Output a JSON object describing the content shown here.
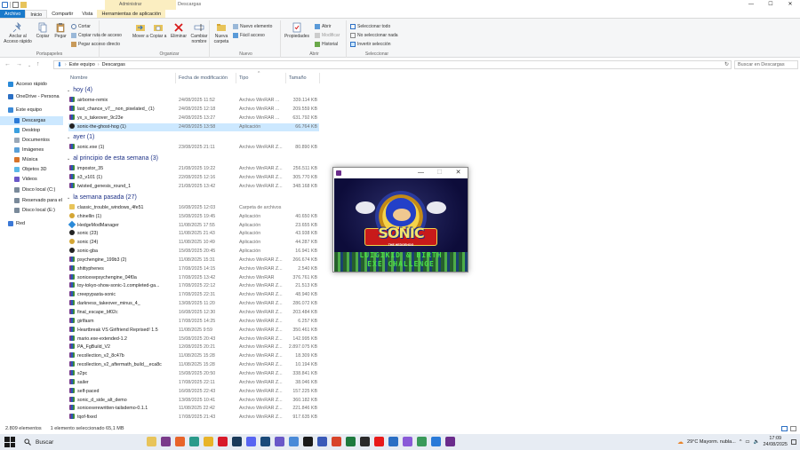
{
  "title": "Descargas",
  "context_tab": "Administrar",
  "ribbon_tabs": [
    "Archivo",
    "Inicio",
    "Compartir",
    "Vista",
    "Herramientas de aplicación"
  ],
  "window_controls": {
    "minimize": "—",
    "maximize": "☐",
    "close": "✕"
  },
  "ribbon": {
    "portapapeles": {
      "label": "Portapapeles",
      "anclar": "Anclar al Acceso rápido",
      "copiar": "Copiar",
      "pegar": "Pegar",
      "cortar": "Cortar",
      "copiar_ruta": "Copiar ruta de acceso",
      "pegar_acceso": "Pegar acceso directo"
    },
    "organizar": {
      "label": "Organizar",
      "mover": "Mover a",
      "copiar": "Copiar a",
      "eliminar": "Eliminar",
      "cambiar": "Cambiar nombre"
    },
    "nuevo": {
      "label": "Nuevo",
      "nueva_carpeta": "Nueva carpeta",
      "nuevo_elemento": "Nuevo elemento",
      "facil_acceso": "Fácil acceso"
    },
    "abrir": {
      "label": "Abrir",
      "propiedades": "Propiedades",
      "abrir": "Abrir",
      "modificar": "Modificar",
      "historial": "Historial"
    },
    "seleccionar": {
      "label": "Seleccionar",
      "todo": "Seleccionar todo",
      "nada": "No seleccionar nada",
      "invertir": "Invertir selección"
    }
  },
  "address": {
    "path": [
      "Este equipo",
      "Descargas"
    ],
    "search_placeholder": "Buscar en Descargas"
  },
  "nav": [
    {
      "label": "Acceso rápido",
      "icon": "star-icon",
      "color": "#2a8ad8"
    },
    {
      "label": "OneDrive - Persona",
      "icon": "cloud-icon",
      "color": "#2b6fc4"
    },
    {
      "label": "Este equipo",
      "icon": "computer-icon",
      "color": "#3b8ad8"
    },
    {
      "label": "Descargas",
      "icon": "download-icon",
      "color": "#2b7bd8",
      "selected": true
    },
    {
      "label": "Desktop",
      "icon": "desktop-icon",
      "color": "#3ba0e0"
    },
    {
      "label": "Documentos",
      "icon": "document-icon",
      "color": "#9aa8b8"
    },
    {
      "label": "Imágenes",
      "icon": "image-icon",
      "color": "#5aa0d8"
    },
    {
      "label": "Música",
      "icon": "music-icon",
      "color": "#d8742a"
    },
    {
      "label": "Objetos 3D",
      "icon": "cube-icon",
      "color": "#5ab8e8"
    },
    {
      "label": "Videos",
      "icon": "video-icon",
      "color": "#6a58c8"
    },
    {
      "label": "Disco local (C:)",
      "icon": "drive-icon",
      "color": "#7a8a9a"
    },
    {
      "label": "Reservado para el",
      "icon": "drive-icon",
      "color": "#7a8a9a"
    },
    {
      "label": "Disco local (E:)",
      "icon": "drive-icon",
      "color": "#7a8a9a"
    },
    {
      "label": "Red",
      "icon": "network-icon",
      "color": "#3b78d6"
    }
  ],
  "columns": {
    "name": "Nombre",
    "date": "Fecha de modificación",
    "type": "Tipo",
    "size": "Tamaño"
  },
  "groups": [
    {
      "header": "hoy (4)",
      "rows": [
        {
          "name": "airborne-remix",
          "date": "24/08/2025 11:52",
          "type": "Archivo WinRAR ...",
          "size": "339.114 KB",
          "icon": "rar"
        },
        {
          "name": "last_chance_v7__non_pixelated_ (1)",
          "date": "24/08/2025 12:18",
          "type": "Archivo WinRAR ...",
          "size": "209.559 KB",
          "icon": "rar"
        },
        {
          "name": "yx_s_takeover_9c23e",
          "date": "24/08/2025 13:27",
          "type": "Archivo WinRAR ...",
          "size": "631.792 KB",
          "icon": "rar"
        },
        {
          "name": "sonic-the-ghost-hog (1)",
          "date": "24/08/2025 13:58",
          "type": "Aplicación",
          "size": "66.764 KB",
          "icon": "dark",
          "selected": true
        }
      ]
    },
    {
      "header": "ayer (1)",
      "rows": [
        {
          "name": "sonic.exe (1)",
          "date": "23/08/2025 21:11",
          "type": "Archivo WinRAR Z...",
          "size": "80.890 KB",
          "icon": "rar"
        }
      ]
    },
    {
      "header": "al principio de esta semana (3)",
      "rows": [
        {
          "name": "impostor_35",
          "date": "21/08/2025 19:22",
          "type": "Archivo WinRAR Z...",
          "size": "256.511 KB",
          "icon": "rar"
        },
        {
          "name": "s3_v101 (1)",
          "date": "22/08/2025 12:16",
          "type": "Archivo WinRAR Z...",
          "size": "305.770 KB",
          "icon": "rar"
        },
        {
          "name": "twisted_genesis_round_1",
          "date": "21/08/2025 13:42",
          "type": "Archivo WinRAR Z...",
          "size": "348.168 KB",
          "icon": "rar"
        }
      ]
    },
    {
      "header": "la semana pasada (27)",
      "rows": [
        {
          "name": "classic_trouble_windows_4fe51",
          "date": "16/08/2025 12:03",
          "type": "Carpeta de archivos",
          "size": "",
          "icon": "folder"
        },
        {
          "name": "chinellin (1)",
          "date": "15/08/2025 19:45",
          "type": "Aplicación",
          "size": "40.650 KB",
          "icon": "gold"
        },
        {
          "name": "HedgeModManager",
          "date": "11/08/2025 17:55",
          "type": "Aplicación",
          "size": "23.655 KB",
          "icon": "star"
        },
        {
          "name": "sonic (23)",
          "date": "11/08/2025 21:43",
          "type": "Aplicación",
          "size": "43.938 KB",
          "icon": "dark"
        },
        {
          "name": "sonic (24)",
          "date": "11/08/2025 10:49",
          "type": "Aplicación",
          "size": "44.287 KB",
          "icon": "gold"
        },
        {
          "name": "sonic-gba",
          "date": "15/08/2025 20:45",
          "type": "Aplicación",
          "size": "16.941 KB",
          "icon": "dark"
        },
        {
          "name": "psychengine_199b3 (2)",
          "date": "11/08/2025 15:31",
          "type": "Archivo WinRAR Z...",
          "size": "266.674 KB",
          "icon": "rar"
        },
        {
          "name": "shittyphenes",
          "date": "17/08/2025 14:15",
          "type": "Archivo WinRAR Z...",
          "size": "2.540 KB",
          "icon": "rar"
        },
        {
          "name": "sonicexepsychengine_04f0a",
          "date": "17/08/2025 13:42",
          "type": "Archivo WinRAR",
          "size": "376.761 KB",
          "icon": "rar"
        },
        {
          "name": "toy-tokyo-show-sonic-1.completed-ga...",
          "date": "17/08/2025 22:12",
          "type": "Archivo WinRAR Z...",
          "size": "21.513 KB",
          "icon": "rar"
        },
        {
          "name": "creepypasta-sonic",
          "date": "17/08/2025 22:31",
          "type": "Archivo WinRAR Z...",
          "size": "48.940 KB",
          "icon": "rar"
        },
        {
          "name": "darkness_takeover_minus_4_",
          "date": "13/08/2025 11:20",
          "type": "Archivo WinRAR Z...",
          "size": "286.072 KB",
          "icon": "rar"
        },
        {
          "name": "final_escape_bf02c",
          "date": "16/08/2025 12:30",
          "type": "Archivo WinRAR Z...",
          "size": "203.484 KB",
          "icon": "rar"
        },
        {
          "name": "girlfasm",
          "date": "17/08/2025 14:25",
          "type": "Archivo WinRAR Z...",
          "size": "6.257 KB",
          "icon": "rar"
        },
        {
          "name": "Heartbreak VS Girlfriend Reprised! 1.5",
          "date": "11/08/2025 9:59",
          "type": "Archivo WinRAR Z...",
          "size": "350.461 KB",
          "icon": "rar"
        },
        {
          "name": "mario.exe-extended-1.2",
          "date": "15/08/2025 20:43",
          "type": "Archivo WinRAR Z...",
          "size": "142.995 KB",
          "icon": "rar"
        },
        {
          "name": "PA_FgBuild_V2",
          "date": "12/08/2025 20:21",
          "type": "Archivo WinRAR Z...",
          "size": "2.897.075 KB",
          "icon": "rar"
        },
        {
          "name": "recollection_v2_8c47b",
          "date": "11/08/2025 15:28",
          "type": "Archivo WinRAR Z...",
          "size": "18.309 KB",
          "icon": "rar"
        },
        {
          "name": "recollection_v2_aftermath_build__eca8c",
          "date": "11/08/2025 15:28",
          "type": "Archivo WinRAR Z...",
          "size": "10.194 KB",
          "icon": "rar"
        },
        {
          "name": "s2pc",
          "date": "15/08/2025 20:50",
          "type": "Archivo WinRAR Z...",
          "size": "338.841 KB",
          "icon": "rar"
        },
        {
          "name": "sailer",
          "date": "17/08/2025 22:11",
          "type": "Archivo WinRAR Z...",
          "size": "38.046 KB",
          "icon": "rar"
        },
        {
          "name": "self-paced",
          "date": "16/08/2025 22:43",
          "type": "Archivo WinRAR Z...",
          "size": "157.225 KB",
          "icon": "rar"
        },
        {
          "name": "sonic_d_side_alt_demo",
          "date": "13/08/2025 10:41",
          "type": "Archivo WinRAR Z...",
          "size": "360.182 KB",
          "icon": "rar"
        },
        {
          "name": "sonicexerewritten-tailsdemo-0.1.1",
          "date": "11/08/2025 22:42",
          "type": "Archivo WinRAR Z...",
          "size": "221.846 KB",
          "icon": "rar"
        },
        {
          "name": "tqof-fixed",
          "date": "17/08/2025 21:43",
          "type": "Archivo WinRAR Z...",
          "size": "917.635 KB",
          "icon": "rar"
        }
      ]
    }
  ],
  "status": {
    "count": "2.809 elementos",
    "selection": "1 elemento seleccionado  65,1 MB"
  },
  "game_window": {
    "logo": "SONIC",
    "subtitle": "THE HEDGEHOG",
    "line1": "LUIGIKID & BIRTH",
    "line2": "EXE  CHALLENGE"
  },
  "taskbar": {
    "search": "Buscar",
    "weather": "29°C  Mayorm. nubla...",
    "time": "17:09",
    "date": "24/08/2025",
    "apps": [
      {
        "icon": "explorer-icon",
        "color": "#e8c45a"
      },
      {
        "icon": "winrar-icon",
        "color": "#7a3b8a"
      },
      {
        "icon": "firefox-icon",
        "color": "#e8642a"
      },
      {
        "icon": "edge-icon",
        "color": "#2a9a8a"
      },
      {
        "icon": "chrome-icon",
        "color": "#e8b42a"
      },
      {
        "icon": "opera-icon",
        "color": "#d81a2a"
      },
      {
        "icon": "steam-icon",
        "color": "#1a3a5a"
      },
      {
        "icon": "discord-icon",
        "color": "#5865f2"
      },
      {
        "icon": "app-icon",
        "color": "#1a4a7a"
      },
      {
        "icon": "app-icon",
        "color": "#6a58c8"
      },
      {
        "icon": "chrome-icon",
        "color": "#4a8ad8"
      },
      {
        "icon": "terminal-icon",
        "color": "#1a1a1a"
      },
      {
        "icon": "app-icon",
        "color": "#3a5ab8"
      },
      {
        "icon": "app-icon",
        "color": "#d8442a"
      },
      {
        "icon": "excel-icon",
        "color": "#1e7a3e"
      },
      {
        "icon": "app-icon",
        "color": "#2a2a2a"
      },
      {
        "icon": "youtube-icon",
        "color": "#e81a1a"
      },
      {
        "icon": "app-icon",
        "color": "#2b6fc4"
      },
      {
        "icon": "app-icon",
        "color": "#8a5ad8"
      },
      {
        "icon": "chrome-icon",
        "color": "#3a9a5a"
      },
      {
        "icon": "app-icon",
        "color": "#2a7ad8"
      },
      {
        "icon": "game-icon",
        "color": "#6b2c8c"
      }
    ]
  }
}
